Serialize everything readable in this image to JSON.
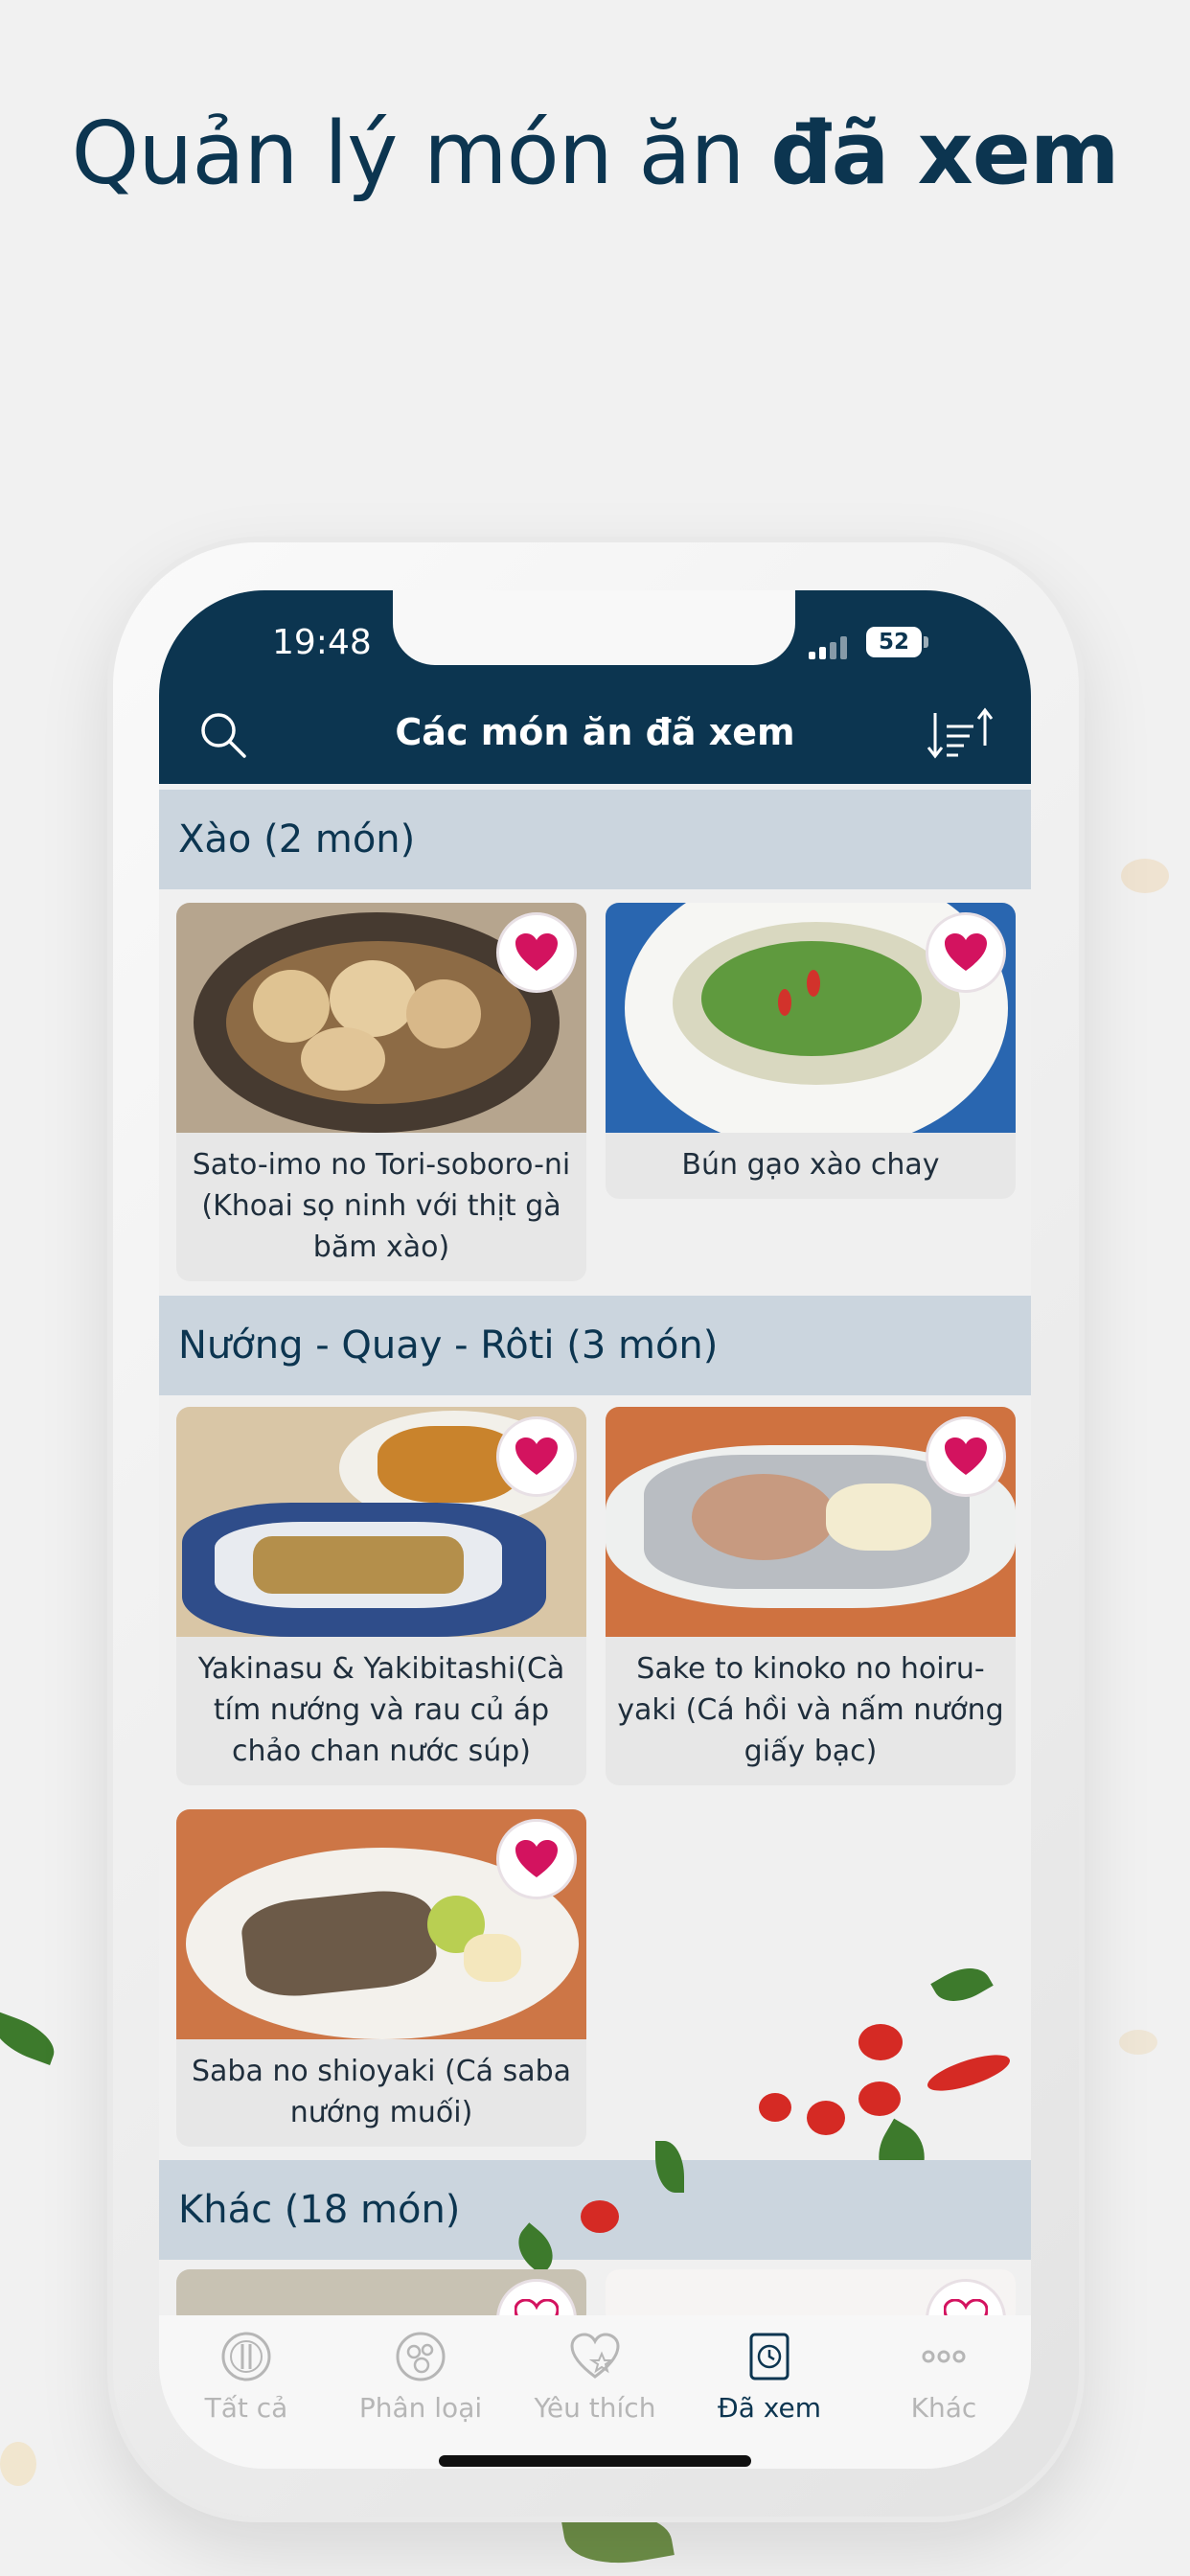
{
  "headline": {
    "regular": "Quản lý món ăn ",
    "bold": "đã xem"
  },
  "status_bar": {
    "time": "19:48",
    "battery": "52"
  },
  "nav": {
    "title": "Các món ăn đã xem"
  },
  "sections": [
    {
      "header": "Xào (2 món)",
      "items": [
        {
          "title": "Sato-imo no Tori-soboro-ni (Khoai sọ ninh với thịt gà băm xào)",
          "favorite": true
        },
        {
          "title": "Bún gạo xào chay",
          "favorite": true
        }
      ]
    },
    {
      "header": "Nướng - Quay - Rôti (3 món)",
      "items": [
        {
          "title": "Yakinasu & Yakibitashi(Cà tím nướng và rau củ áp chảo chan nước súp)",
          "favorite": true
        },
        {
          "title": "Sake to kinoko no hoiru-yaki (Cá hồi và nấm nướng giấy bạc)",
          "favorite": true
        },
        {
          "title": "Saba no shioyaki (Cá saba nướng muối)",
          "favorite": true
        }
      ]
    },
    {
      "header": "Khác (18 món)",
      "items": []
    }
  ],
  "tabbar": {
    "tabs": [
      {
        "label": "Tất cả",
        "icon": "plate-icon",
        "active": false
      },
      {
        "label": "Phân loại",
        "icon": "category-icon",
        "active": false
      },
      {
        "label": "Yêu thích",
        "icon": "heart-star-icon",
        "active": false
      },
      {
        "label": "Đã xem",
        "icon": "history-icon",
        "active": true
      },
      {
        "label": "Khác",
        "icon": "more-icon",
        "active": false
      }
    ]
  },
  "colors": {
    "navy": "#0c3550",
    "section_bg": "#cbd5de",
    "heart": "#d3135f",
    "tab_inactive": "#b6b6b6"
  }
}
